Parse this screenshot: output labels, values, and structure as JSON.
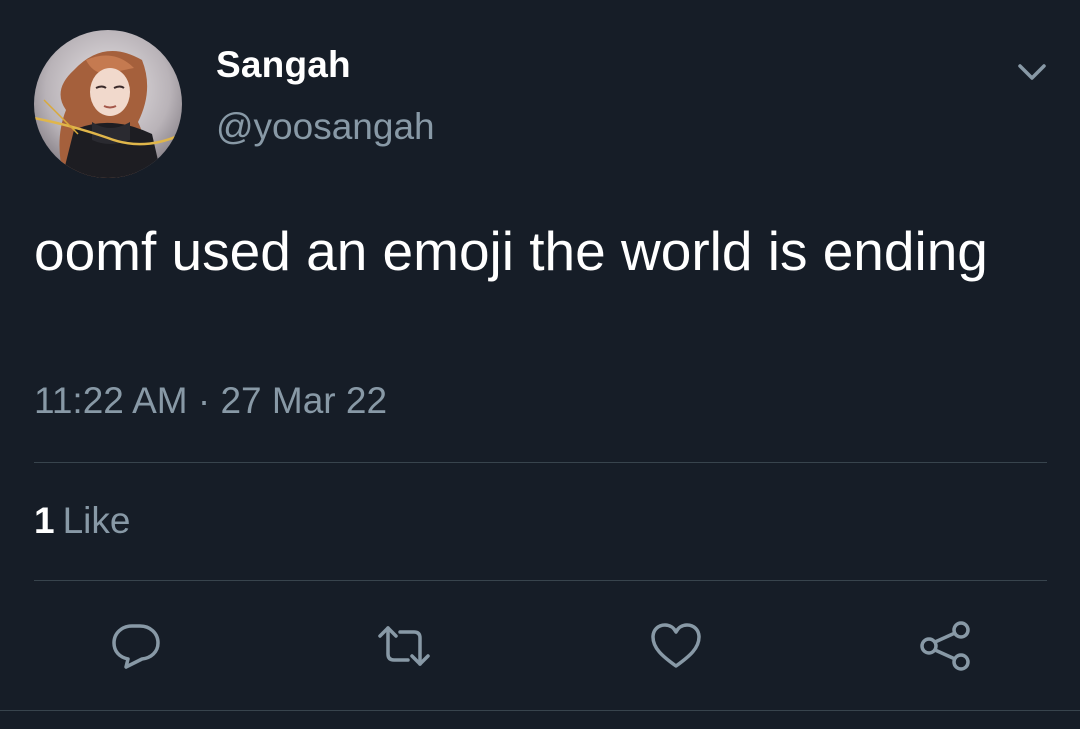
{
  "user": {
    "display_name": "Sangah",
    "handle": "@yoosangah",
    "avatar_icon": "profile-avatar"
  },
  "tweet": {
    "text": "oomf used an emoji the world is ending",
    "timestamp": "11:22 AM · 27 Mar 22",
    "likes_count": "1",
    "likes_label": "Like"
  },
  "icons": {
    "menu": "chevron-down-icon",
    "reply": "reply-icon",
    "retweet": "retweet-icon",
    "like": "heart-icon",
    "share": "share-icon"
  },
  "colors": {
    "background": "#161d27",
    "text_primary": "#ffffff",
    "text_secondary": "#8899a6",
    "divider": "#38444d"
  }
}
